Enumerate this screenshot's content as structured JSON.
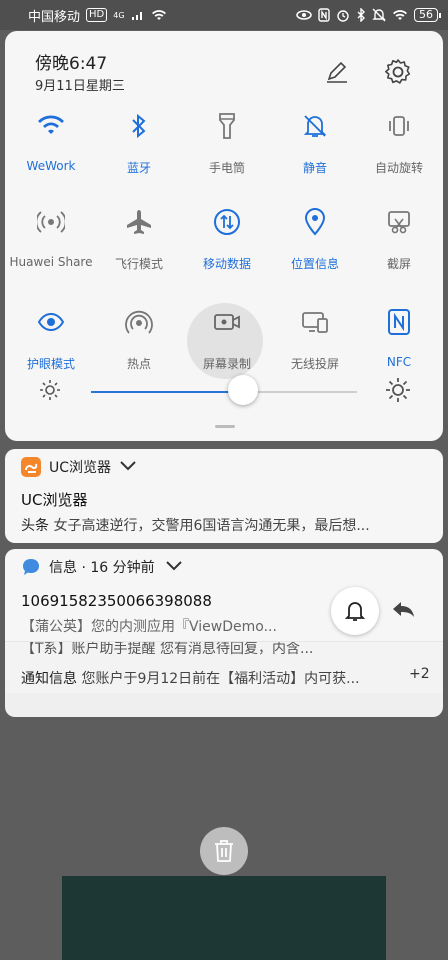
{
  "status_bar": {
    "carrier": "中国移动",
    "hd_badge": "HD",
    "net_type": "4G",
    "battery_level": "56",
    "icons": [
      "eye-icon",
      "nfc-icon",
      "alarm-icon",
      "bluetooth-icon",
      "mute-icon",
      "wifi-icon"
    ]
  },
  "panel": {
    "time": "傍晚6:47",
    "date": "9月11日星期三",
    "tiles": [
      {
        "label": "WeWork",
        "icon": "wifi-icon",
        "active": true
      },
      {
        "label": "蓝牙",
        "icon": "bluetooth-icon",
        "active": true
      },
      {
        "label": "手电筒",
        "icon": "flashlight-icon",
        "active": false
      },
      {
        "label": "静音",
        "icon": "mute-icon",
        "active": true
      },
      {
        "label": "自动旋转",
        "icon": "rotate-icon",
        "active": false
      },
      {
        "label": "Huawei Share",
        "icon": "share-icon",
        "active": false
      },
      {
        "label": "飞行模式",
        "icon": "airplane-icon",
        "active": false
      },
      {
        "label": "移动数据",
        "icon": "mobile-data-icon",
        "active": true
      },
      {
        "label": "位置信息",
        "icon": "location-icon",
        "active": true
      },
      {
        "label": "截屏",
        "icon": "screenshot-icon",
        "active": false
      },
      {
        "label": "护眼模式",
        "icon": "eye-comfort-icon",
        "active": true
      },
      {
        "label": "热点",
        "icon": "hotspot-icon",
        "active": false
      },
      {
        "label": "屏幕录制",
        "icon": "screen-record-icon",
        "active": false
      },
      {
        "label": "无线投屏",
        "icon": "wireless-projection-icon",
        "active": false
      },
      {
        "label": "NFC",
        "icon": "nfc-icon",
        "active": true
      }
    ],
    "brightness": 0.57
  },
  "notifications": {
    "uc": {
      "app": "UC浏览器",
      "title": "UC浏览器",
      "tag": "头条",
      "body": "女子高速逆行，交警用6国语言沟通无果，最后想..."
    },
    "sms": {
      "app": "信息 · 16 分钟前",
      "title": "10691582350066398088",
      "body": "【蒲公英】您的内测应用『ViewDemo..."
    },
    "group": {
      "partial": "【T系】账户助手提醒 您有消息待回复，内含...",
      "title": "通知信息",
      "body": "您账户于9月12日前在【福利活动】内可获...",
      "more": "+2"
    }
  }
}
